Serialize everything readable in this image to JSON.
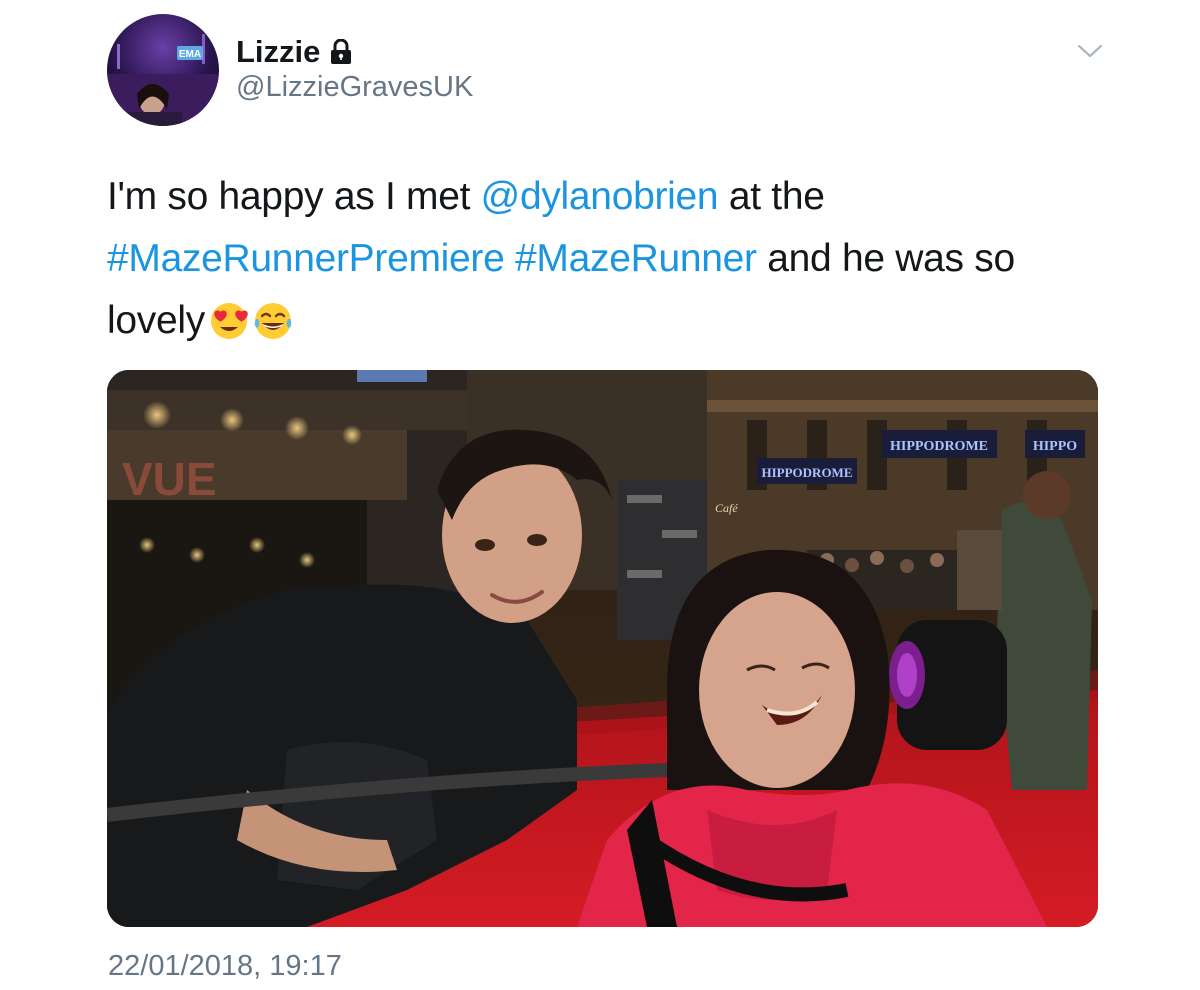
{
  "tweet": {
    "author": {
      "display_name": "Lizzie",
      "handle": "@LizzieGravesUK",
      "avatar_badge_text": "EMA",
      "protected_icon": "lock-icon"
    },
    "menu_icon": "chevron-down-icon",
    "text": {
      "part1": "I'm so happy as I met ",
      "mention": "@dylanobrien",
      "part2": " at the ",
      "hashtag1": "#MazeRunnerPremiere",
      "space": " ",
      "hashtag2": "#MazeRunner",
      "part3": " and he was so lovely",
      "emojis": [
        "heart-eyes-emoji",
        "tears-of-joy-emoji"
      ]
    },
    "photo": {
      "signs": {
        "vue": "VUE",
        "hippodrome_1": "HIPPODROME",
        "hippodrome_2": "HIPPODROME",
        "hippodrome_3": "HIPPO",
        "cafe": "Café"
      }
    },
    "timestamp": "22/01/2018, 19:17"
  },
  "colors": {
    "link": "#1b95e0",
    "text": "#14171a",
    "secondary": "#657786",
    "carpet": "#c8151d"
  }
}
